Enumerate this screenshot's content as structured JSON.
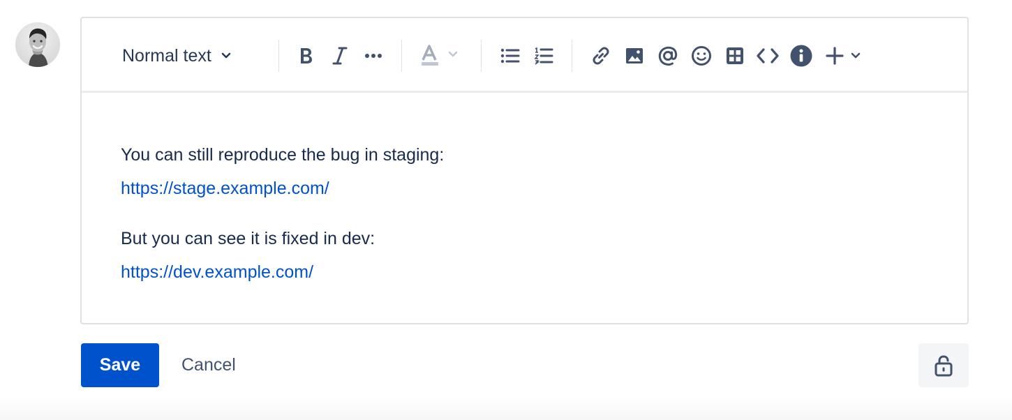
{
  "toolbar": {
    "text_style_label": "Normal text"
  },
  "content": {
    "paragraphs": [
      {
        "text": "You can still reproduce the bug in staging:",
        "link": "https://stage.example.com/"
      },
      {
        "text": "But you can see it is fixed in dev:",
        "link": "https://dev.example.com/"
      }
    ]
  },
  "actions": {
    "save_label": "Save",
    "cancel_label": "Cancel"
  },
  "colors": {
    "primary": "#0052cc",
    "text": "#172b4d",
    "toolbar_icon": "#42526e",
    "border": "#dfe1e6"
  },
  "icons": {
    "text_style_dropdown": "chevron-down-icon",
    "bold": "bold-icon",
    "italic": "italic-icon",
    "more_formatting": "more-icon",
    "text_color": "text-color-icon",
    "bullet_list": "bullet-list-icon",
    "numbered_list": "numbered-list-icon",
    "link": "link-icon",
    "image": "image-icon",
    "mention": "mention-icon",
    "emoji": "emoji-icon",
    "table": "table-icon",
    "code": "code-icon",
    "info": "info-icon",
    "insert": "plus-icon",
    "restrictions": "unlock-icon"
  }
}
